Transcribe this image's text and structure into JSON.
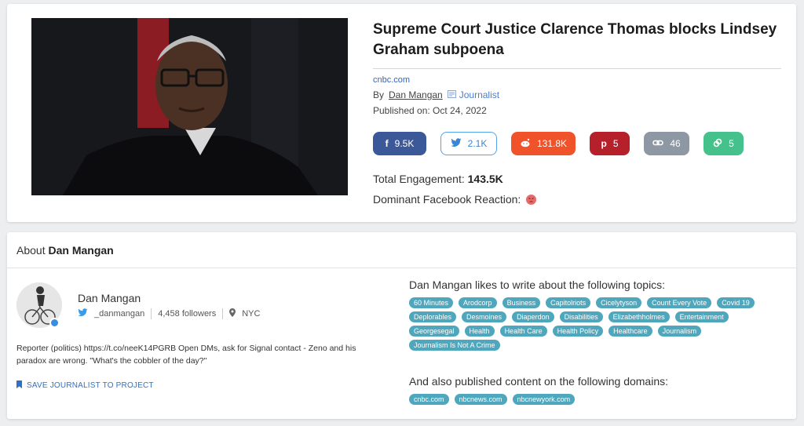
{
  "article": {
    "headline": "Supreme Court Justice Clarence Thomas blocks Lindsey Graham subpoena",
    "source": "cnbc.com",
    "by_prefix": "By",
    "author": "Dan Mangan",
    "author_role": "Journalist",
    "published": "Published on: Oct 24, 2022",
    "shares": {
      "facebook": "9.5K",
      "twitter": "2.1K",
      "reddit": "131.8K",
      "pinterest": "5",
      "links": "46",
      "other": "5"
    },
    "engagement_label": "Total Engagement:",
    "engagement_value": "143.5K",
    "reaction_label": "Dominant Facebook Reaction:",
    "reaction_icon": "angry-face"
  },
  "about": {
    "prefix": "About",
    "name": "Dan Mangan",
    "profile_name": "Dan Mangan",
    "handle": "_danmangan",
    "followers": "4,458 followers",
    "location": "NYC",
    "bio": "Reporter (politics) https://t.co/neeK14PGRB Open DMs, ask for Signal contact - Zeno and his paradox are wrong. \"What's the cobbler of the day?\"",
    "save_label": "SAVE JOURNALIST TO PROJECT",
    "topics_title": "Dan Mangan likes to write about the following topics:",
    "topics": [
      "60 Minutes",
      "Arodcorp",
      "Business",
      "Capitolriots",
      "Cicelytyson",
      "Count Every Vote",
      "Covid 19",
      "Deplorables",
      "Desmoines",
      "Diaperdon",
      "Disabilities",
      "Elizabethholmes",
      "Entertainment",
      "Georgesegal",
      "Health",
      "Health Care",
      "Health Policy",
      "Healthcare",
      "Journalism",
      "Journalism Is Not A Crime"
    ],
    "domains_title": "And also published content on the following domains:",
    "domains": [
      "cnbc.com",
      "nbcnews.com",
      "nbcnewyork.com"
    ]
  },
  "colors": {
    "facebook": "#3b5998",
    "twitter": "#54a3ea",
    "reddit": "#f0522a",
    "pinterest": "#b5202b",
    "links": "#8d98a4",
    "other": "#45c18b",
    "tag": "#4ea7bd"
  }
}
